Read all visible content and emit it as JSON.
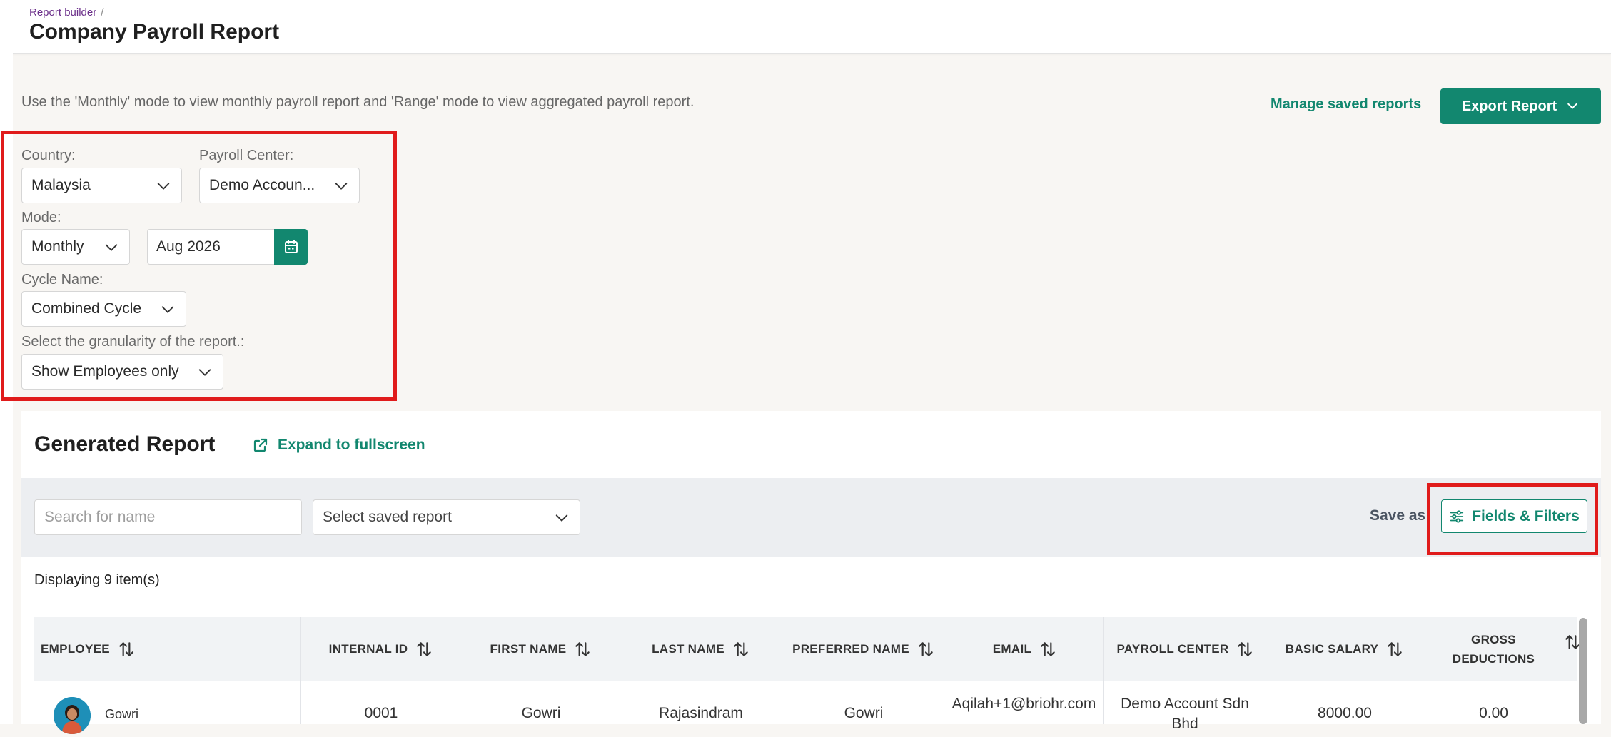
{
  "header": {
    "breadcrumb": "Report builder",
    "breadcrumb_sep": "/",
    "title": "Company Payroll Report"
  },
  "intro_text": "Use the 'Monthly' mode to view monthly payroll report and 'Range' mode to view aggregated payroll report.",
  "actions": {
    "manage_saved": "Manage saved reports",
    "export": "Export Report"
  },
  "filters": {
    "country_label": "Country:",
    "country_value": "Malaysia",
    "payroll_center_label": "Payroll Center:",
    "payroll_center_value": "Demo Accoun...",
    "mode_label": "Mode:",
    "mode_value": "Monthly",
    "date_value": "Aug 2026",
    "cycle_label": "Cycle Name:",
    "cycle_value": "Combined Cycle",
    "granularity_label": "Select the granularity of the report.:",
    "granularity_value": "Show Employees only"
  },
  "report": {
    "title": "Generated Report",
    "expand_label": "Expand to fullscreen",
    "search_placeholder": "Search for name",
    "saved_report_placeholder": "Select saved report",
    "save_as": "Save as",
    "fields_filters": "Fields & Filters",
    "displaying": "Displaying 9 item(s)"
  },
  "table": {
    "columns": [
      "EMPLOYEE",
      "INTERNAL ID",
      "FIRST NAME",
      "LAST NAME",
      "PREFERRED NAME",
      "EMAIL",
      "PAYROLL CENTER",
      "BASIC SALARY",
      "GROSS DEDUCTIONS"
    ],
    "rows": [
      {
        "employee": "Gowri",
        "internal_id": "0001",
        "first_name": "Gowri",
        "last_name": "Rajasindram",
        "preferred_name": "Gowri",
        "email": "Aqilah+1@briohr.com",
        "payroll_center": "Demo Account Sdn Bhd",
        "basic_salary": "8000.00",
        "gross_deductions": "0.00"
      }
    ]
  },
  "colors": {
    "accent": "#12876f",
    "highlight": "#e01b1b"
  }
}
